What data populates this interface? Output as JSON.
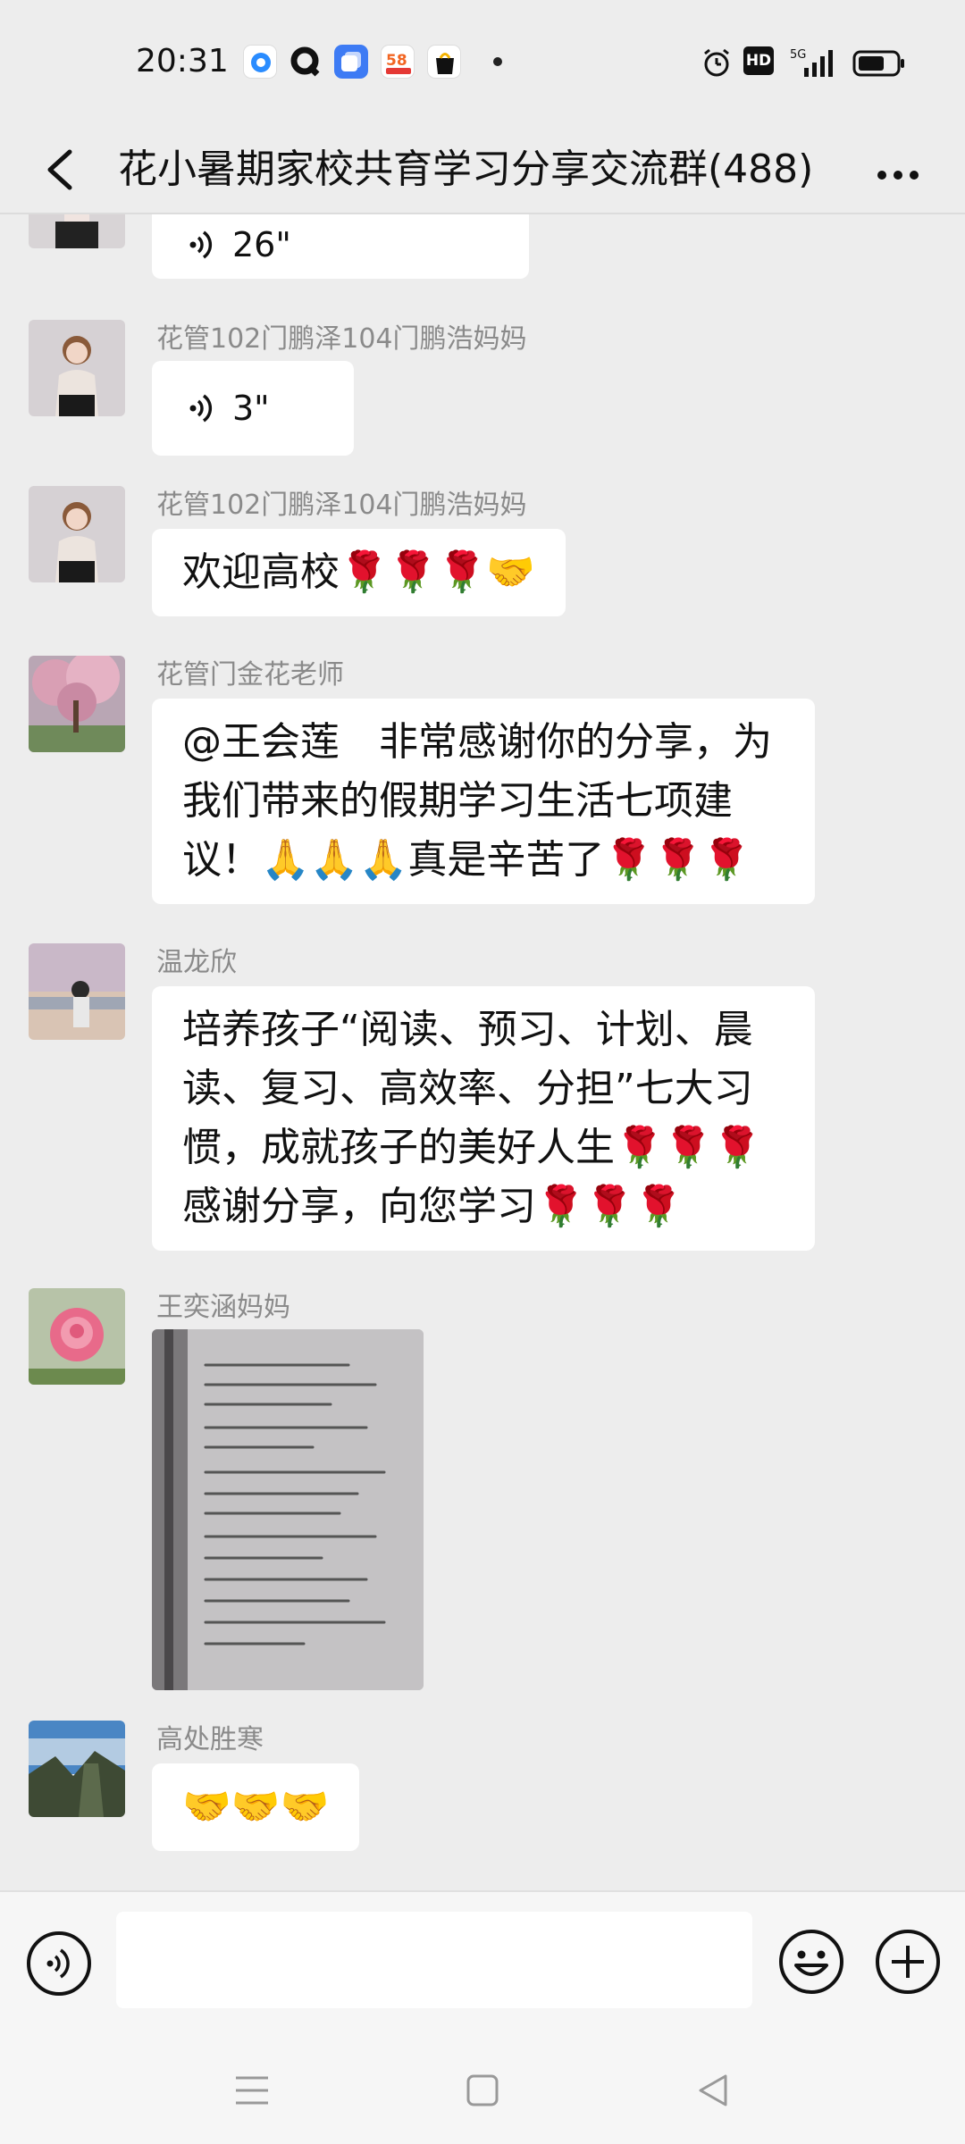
{
  "status_bar": {
    "time": "20:31",
    "left_icons": [
      "browser-icon",
      "q-icon",
      "app-icon",
      "58-app-icon",
      "bag-app-icon"
    ],
    "right_icons": [
      "alarm-icon",
      "hd-icon",
      "5g-signal-icon",
      "battery-icon"
    ],
    "hd_label": "HD",
    "network": "5G"
  },
  "header": {
    "title": "花小暑期家校共育学习分享交流群(488)"
  },
  "messages": [
    {
      "type": "voice",
      "sender": "",
      "duration": "26\""
    },
    {
      "type": "voice",
      "sender": "花管102门鹏泽104门鹏浩妈妈",
      "duration": "3\""
    },
    {
      "type": "text",
      "sender": "花管102门鹏泽104门鹏浩妈妈",
      "lines": [
        "欢迎高校🌹🌹🌹🤝"
      ]
    },
    {
      "type": "text",
      "sender": "花管门金花老师",
      "lines": [
        "@王会莲　非常感谢你的分享，为",
        "我们带来的假期学习生活七项建",
        "议！🙏🙏🙏真是辛苦了🌹🌹🌹"
      ]
    },
    {
      "type": "text",
      "sender": "温龙欣",
      "lines": [
        "培养孩子“阅读、预习、计划、晨",
        "读、复习、高效率、分担”七大习",
        "惯，成就孩子的美好人生🌹🌹🌹",
        "感谢分享，向您学习🌹🌹🌹"
      ]
    },
    {
      "type": "image",
      "sender": "王奕涵妈妈"
    },
    {
      "type": "text",
      "sender": "高处胜寒",
      "lines": [
        "🤝🤝🤝"
      ]
    }
  ],
  "input_bar": {
    "placeholder": ""
  },
  "colors": {
    "background": "#ededed",
    "bubble": "#ffffff",
    "sender_text": "#8a8a8a",
    "input_bar": "#f6f6f6"
  }
}
